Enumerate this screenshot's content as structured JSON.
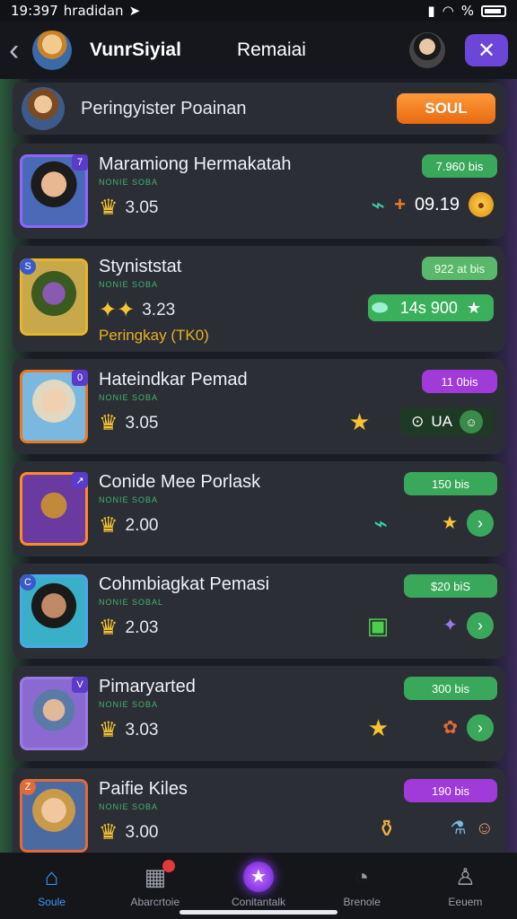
{
  "status_bar": {
    "time": "19:397",
    "carrier": "hradidan",
    "battery": "%"
  },
  "header": {
    "title": "VunrSiyial",
    "subtitle": "Remaiai",
    "back_icon": "chevron-left-icon",
    "close_icon": "close-icon"
  },
  "banner": {
    "text": "Peringyister Poainan",
    "button_label": "SOUL"
  },
  "cards": [
    {
      "name": "Maramiong Hermakatah",
      "sub": "NONIE SOBA",
      "rating": "3.05",
      "tag": "7.960 bis",
      "score": "09.19",
      "color": "#7b5be0"
    },
    {
      "name": "Styniststat",
      "sub": "NONIE SOBA",
      "rating": "3.23",
      "rank": "Peringkay (TK0)",
      "tag": "922 at bis",
      "pill": "14s 900"
    },
    {
      "name": "Hateindkar Pemad",
      "sub": "NONIE SOBA",
      "rating": "3.05",
      "tag": "11 0bis",
      "pill": "UA"
    },
    {
      "name": "Conide Mee Porlask",
      "sub": "NONIE SOBA",
      "rating": "2.00",
      "tag": "150 bis"
    },
    {
      "name": "Cohmbiagkat Pemasi",
      "sub": "NONIE SOBAL",
      "rating": "2.03",
      "tag": "$20 biS"
    },
    {
      "name": "Pimaryarted",
      "sub": "NONIE SOBA",
      "rating": "3.03",
      "tag": "300 bis"
    },
    {
      "name": "Paifie Kiles",
      "sub": "NONIE SOBA",
      "rating": "3.00",
      "tag": "190 bis"
    }
  ],
  "nav": [
    {
      "label": "Soule",
      "icon": "home-icon"
    },
    {
      "label": "Abarcrtoie",
      "icon": "box-icon"
    },
    {
      "label": "Conitantalk",
      "icon": "star-icon"
    },
    {
      "label": "Brenole",
      "icon": "clock-icon"
    },
    {
      "label": "Eeuem",
      "icon": "user-icon"
    }
  ]
}
